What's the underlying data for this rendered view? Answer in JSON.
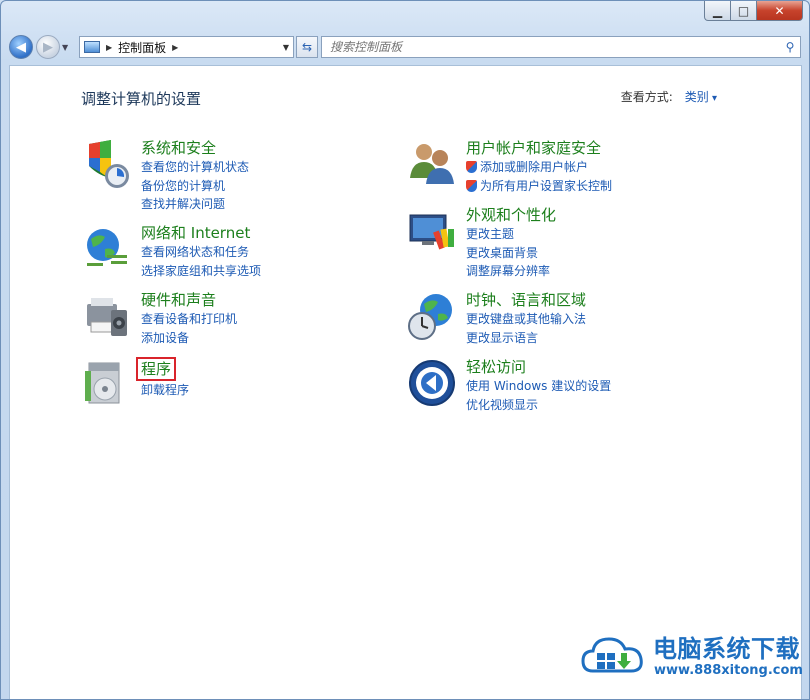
{
  "window": {
    "caption": {
      "minimize": "▁",
      "maximize": "□",
      "close": "✕"
    }
  },
  "navbar": {
    "address_text": "控制面板",
    "search_placeholder": "搜索控制面板"
  },
  "page": {
    "heading": "调整计算机的设置",
    "viewby_label": "查看方式:",
    "viewby_value": "类别"
  },
  "categories": [
    {
      "title": "系统和安全",
      "icon": "system-security-icon",
      "links": [
        "查看您的计算机状态",
        "备份您的计算机",
        "查找并解决问题"
      ]
    },
    {
      "title": "网络和 Internet",
      "icon": "network-icon",
      "links": [
        "查看网络状态和任务",
        "选择家庭组和共享选项"
      ]
    },
    {
      "title": "硬件和声音",
      "icon": "hardware-sound-icon",
      "links": [
        "查看设备和打印机",
        "添加设备"
      ]
    },
    {
      "title": "程序",
      "icon": "programs-icon",
      "links": [
        "卸载程序"
      ]
    },
    {
      "title": "用户帐户和家庭安全",
      "icon": "user-accounts-icon",
      "links": [
        "添加或删除用户帐户",
        "为所有用户设置家长控制"
      ]
    },
    {
      "title": "外观和个性化",
      "icon": "appearance-icon",
      "links": [
        "更改主题",
        "更改桌面背景",
        "调整屏幕分辨率"
      ]
    },
    {
      "title": "时钟、语言和区域",
      "icon": "clock-region-icon",
      "links": [
        "更改键盘或其他输入法",
        "更改显示语言"
      ]
    },
    {
      "title": "轻松访问",
      "icon": "ease-of-access-icon",
      "links": [
        "使用 Windows 建议的设置",
        "优化视频显示"
      ]
    }
  ],
  "watermark": {
    "title": "电脑系统下载",
    "url": "www.888xitong.com"
  },
  "colors": {
    "category_title": "#1c7f1c",
    "link": "#1e5bb4",
    "highlight_box": "#d9242b"
  }
}
